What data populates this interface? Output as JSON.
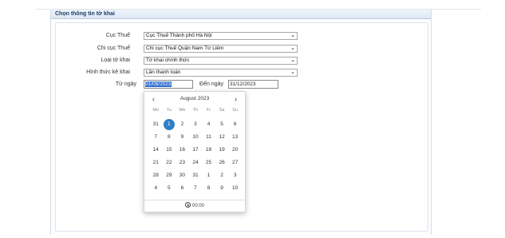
{
  "section": {
    "title": "Chọn thông tin tờ khai"
  },
  "form": {
    "cuc_thue": {
      "label": "Cục Thuế",
      "value": "Cục Thuế Thành phố Hà Nội"
    },
    "chi_cuc_thue": {
      "label": "Chi cục Thuế",
      "value": "Chi cục Thuế Quận Nam Từ Liêm"
    },
    "loai_to_khai": {
      "label": "Loại tờ khai",
      "value": "Tờ khai chính thức"
    },
    "hinh_thuc_ke_khai": {
      "label": "Hình thức kê khai",
      "value": "Lần thanh toán"
    },
    "tu_ngay": {
      "label": "Từ ngày",
      "value": "01/08/2023"
    },
    "den_ngay": {
      "label": "Đến ngày",
      "value": "31/12/2023"
    }
  },
  "calendar": {
    "title": "August 2023",
    "prev_icon": "‹",
    "next_icon": "›",
    "weekdays": [
      "Mo",
      "Tu",
      "We",
      "Th",
      "Fr",
      "Sa",
      "Su"
    ],
    "weeks": [
      [
        "31",
        "1",
        "2",
        "3",
        "4",
        "5",
        "6"
      ],
      [
        "7",
        "8",
        "9",
        "10",
        "11",
        "12",
        "13"
      ],
      [
        "14",
        "15",
        "16",
        "17",
        "18",
        "19",
        "20"
      ],
      [
        "21",
        "22",
        "23",
        "24",
        "25",
        "26",
        "27"
      ],
      [
        "28",
        "29",
        "30",
        "31",
        "1",
        "2",
        "3"
      ],
      [
        "4",
        "5",
        "6",
        "7",
        "8",
        "9",
        "10"
      ]
    ],
    "selected_day": "1",
    "time": "00:00"
  },
  "colors": {
    "accent": "#2f7fc4",
    "highlight": "#2f6fd0",
    "header_text": "#1a3d66"
  }
}
